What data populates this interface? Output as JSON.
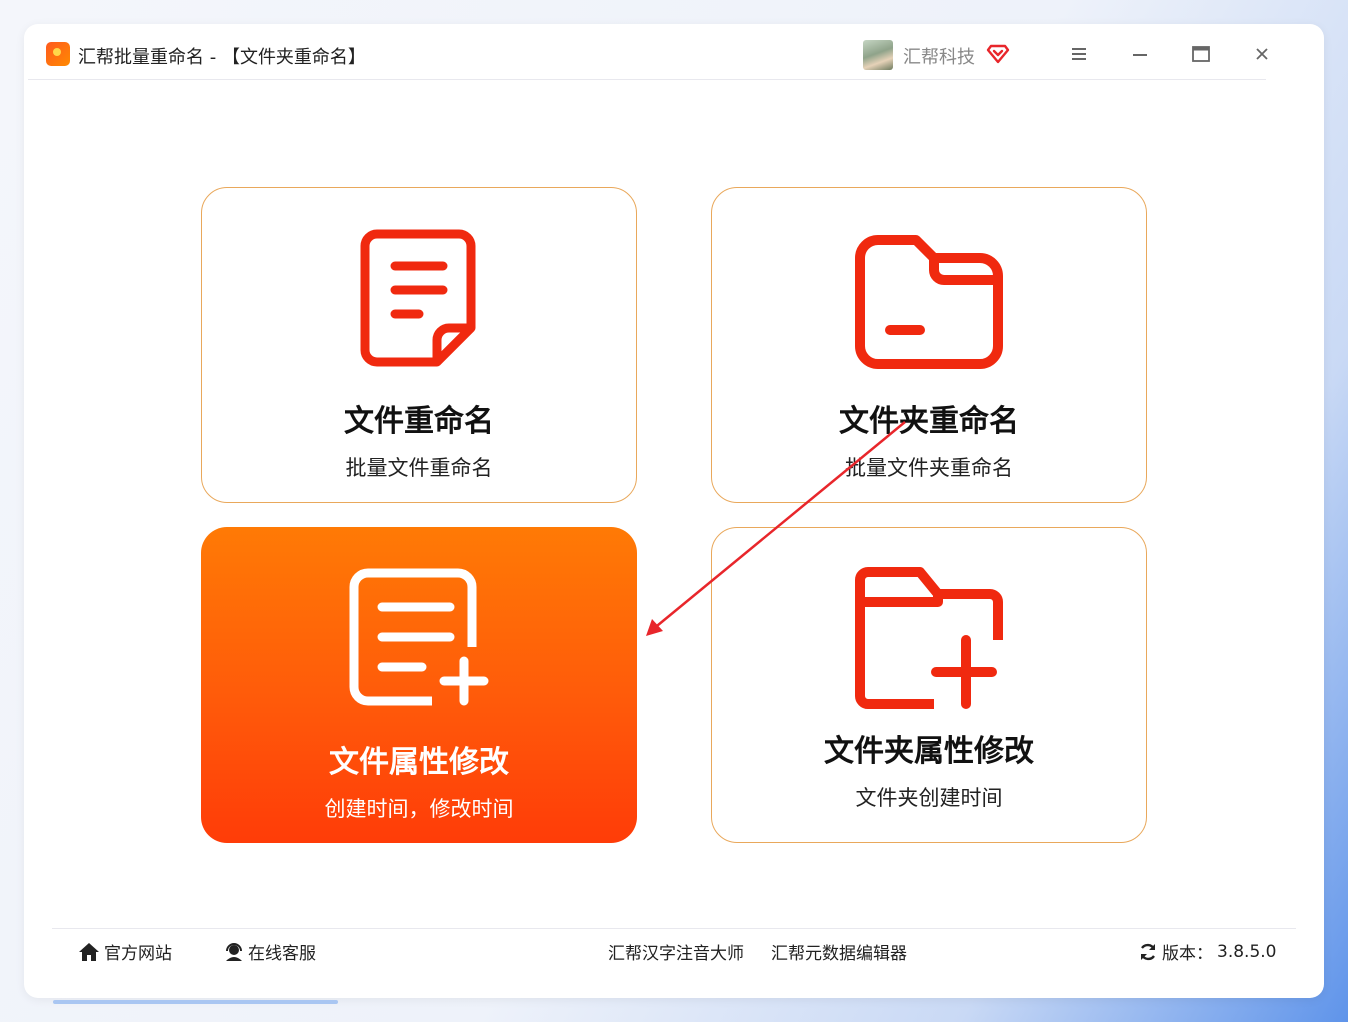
{
  "app": {
    "title": "汇帮批量重命名 - 【文件夹重命名】"
  },
  "user": {
    "name": "汇帮科技"
  },
  "window_controls": {
    "menu_icon": "menu-icon",
    "minimize_icon": "minimize-icon",
    "maximize_icon": "maximize-icon",
    "close_icon": "close-icon"
  },
  "cards": [
    {
      "title": "文件重命名",
      "subtitle": "批量文件重命名",
      "icon": "document-icon",
      "active": false
    },
    {
      "title": "文件夹重命名",
      "subtitle": "批量文件夹重命名",
      "icon": "folder-icon",
      "active": false
    },
    {
      "title": "文件属性修改",
      "subtitle": "创建时间，修改时间",
      "icon": "document-add-icon",
      "active": true
    },
    {
      "title": "文件夹属性修改",
      "subtitle": "文件夹创建时间",
      "icon": "folder-add-icon",
      "active": false
    }
  ],
  "footer": {
    "website": "官方网站",
    "support": "在线客服",
    "link1": "汇帮汉字注音大师",
    "link2": "汇帮元数据编辑器",
    "version_label": "版本：",
    "version": "3.8.5.0"
  },
  "colors": {
    "accent": "#ff5a0a",
    "icon_red": "#f0290f",
    "card_border": "#e9a85b",
    "annotation_arrow": "#e8262b"
  }
}
